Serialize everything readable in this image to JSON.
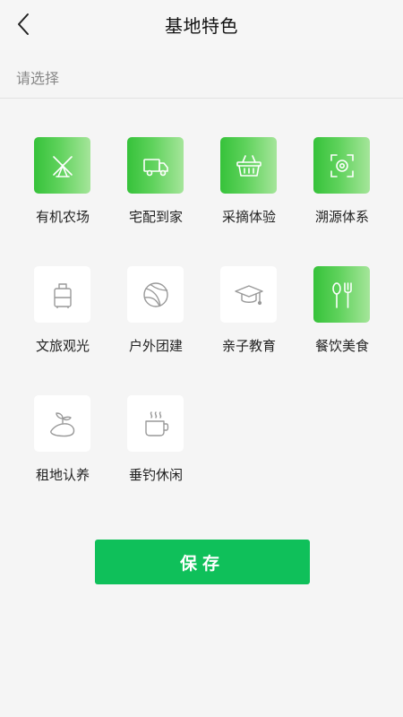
{
  "header": {
    "title": "基地特色",
    "back_icon": "chevron-left-icon"
  },
  "selector": {
    "placeholder": "请选择"
  },
  "colors": {
    "selected_gradient_start": "#36c23a",
    "selected_gradient_end": "#a5e59a",
    "save_button": "#0fc05a",
    "background": "#f5f5f5"
  },
  "features": [
    {
      "label": "有机农场",
      "icon": "windmill-icon",
      "selected": true
    },
    {
      "label": "宅配到家",
      "icon": "truck-icon",
      "selected": true
    },
    {
      "label": "采摘体验",
      "icon": "basket-icon",
      "selected": true
    },
    {
      "label": "溯源体系",
      "icon": "scan-target-icon",
      "selected": true
    },
    {
      "label": "文旅观光",
      "icon": "luggage-icon",
      "selected": false
    },
    {
      "label": "户外团建",
      "icon": "ball-icon",
      "selected": false
    },
    {
      "label": "亲子教育",
      "icon": "graduation-cap-icon",
      "selected": false
    },
    {
      "label": "餐饮美食",
      "icon": "spoon-fork-icon",
      "selected": true
    },
    {
      "label": "租地认养",
      "icon": "sprout-land-icon",
      "selected": false
    },
    {
      "label": "垂钓休闲",
      "icon": "tea-cup-icon",
      "selected": false
    }
  ],
  "save_button": {
    "label": "保存"
  }
}
